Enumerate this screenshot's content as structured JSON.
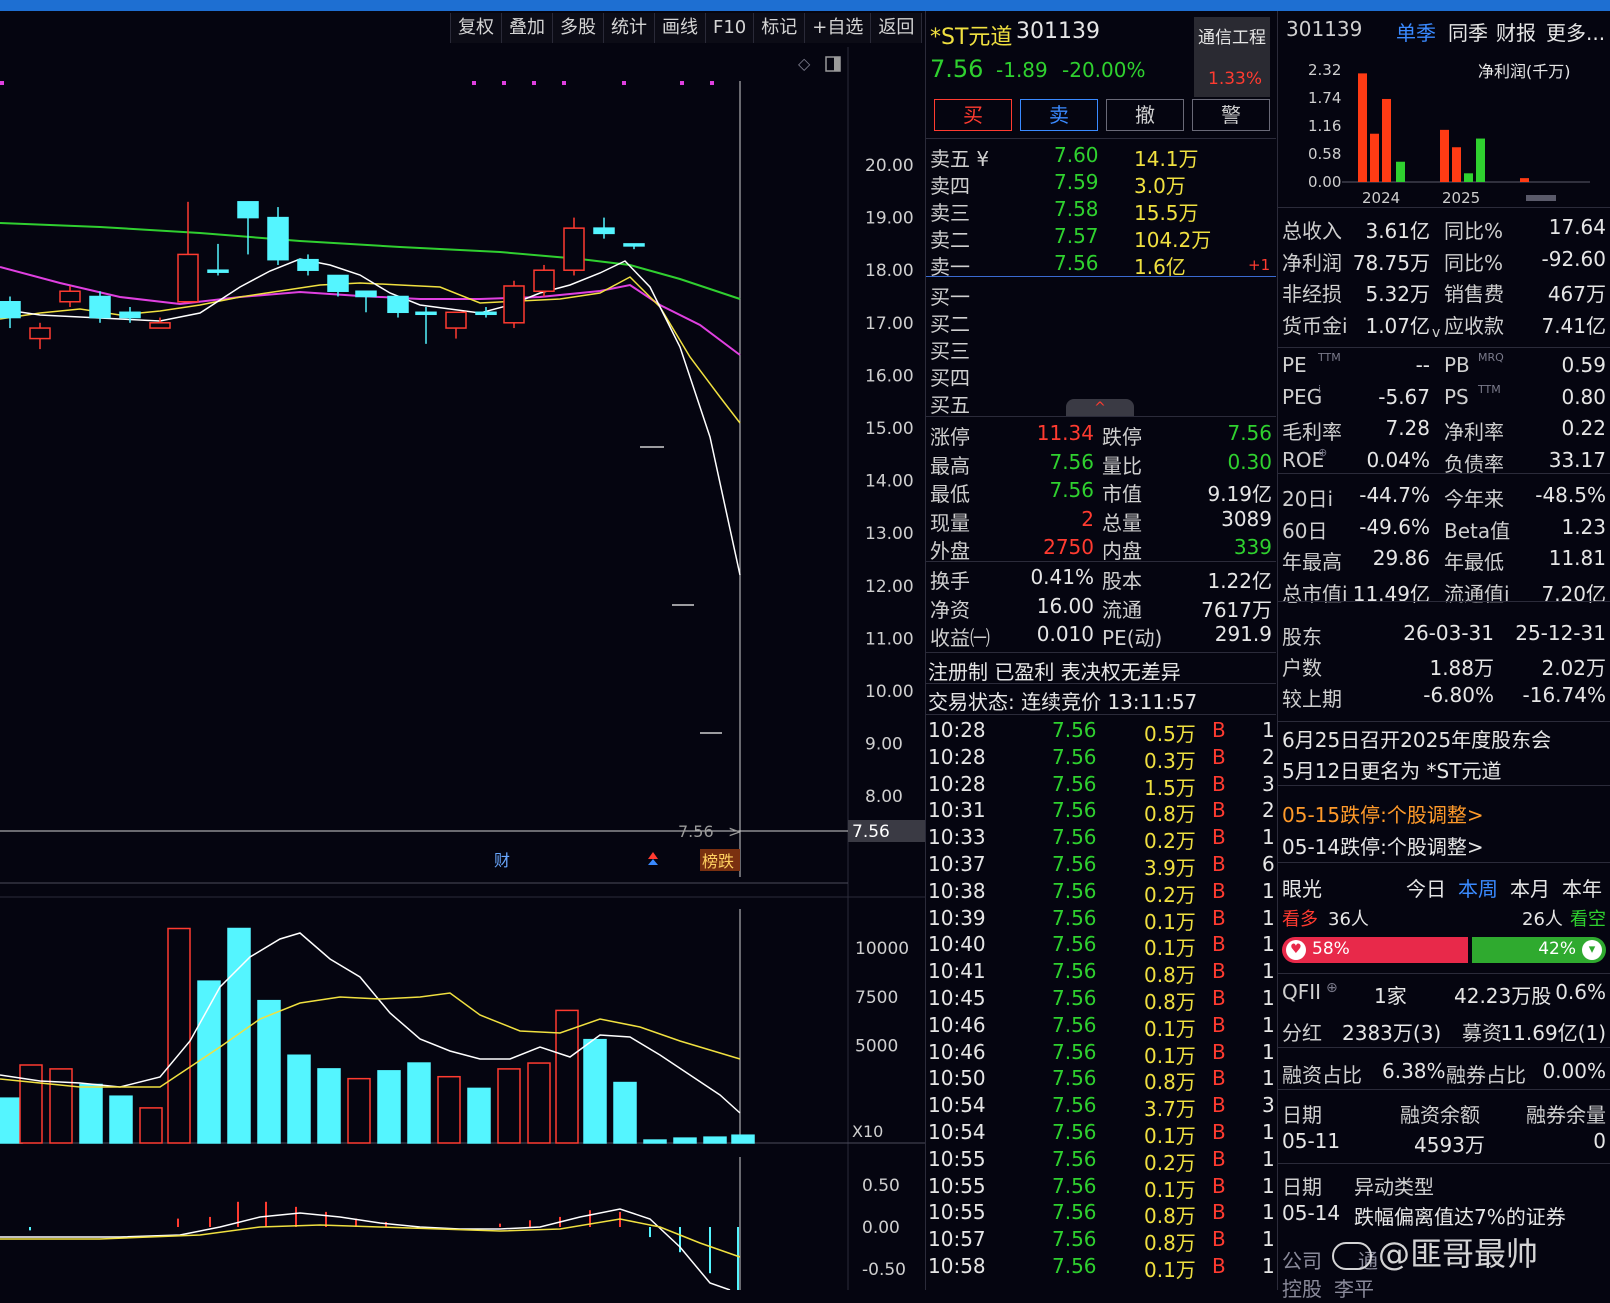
{
  "toolbar": [
    "复权",
    "叠加",
    "多股",
    "统计",
    "画线",
    "F10",
    "标记",
    "+自选",
    "返回"
  ],
  "chart": {
    "price_ticks": [
      "20.00",
      "19.00",
      "18.00",
      "17.00",
      "16.00",
      "15.00",
      "14.00",
      "13.00",
      "12.00",
      "11.00",
      "10.00",
      "9.00",
      "8.00"
    ],
    "last_price_tag": "7.56",
    "last_price_marker": "7.56",
    "last_price_arrow": ">",
    "marker_cai": "财",
    "marker_bang": "榜跌",
    "vol_ticks": [
      "10000",
      "7500",
      "5000"
    ],
    "vol_scale": "X10",
    "macd_ticks": [
      "0.50",
      "0.00",
      "-0.50"
    ],
    "colors": {
      "up": "#ff3b30",
      "down": "#54f5ff",
      "ma5": "#ffffff",
      "ma10": "#f0e040",
      "ma20": "#e040e0",
      "ma60": "#30d030"
    }
  },
  "quote": {
    "name": "*ST元道",
    "code": "301139",
    "sector": "通信工程",
    "sector_change": "1.33%",
    "price": "7.56",
    "change": "-1.89",
    "change_pct": "-20.00%",
    "buttons": {
      "buy": "买",
      "sell": "卖",
      "cancel": "撤",
      "alert": "警"
    },
    "asks": [
      {
        "label": "卖五 ¥",
        "price": "7.60",
        "vol": "14.1万",
        "extra": ""
      },
      {
        "label": "卖四",
        "price": "7.59",
        "vol": "3.0万",
        "extra": ""
      },
      {
        "label": "卖三",
        "price": "7.58",
        "vol": "15.5万",
        "extra": ""
      },
      {
        "label": "卖二",
        "price": "7.57",
        "vol": "104.2万",
        "extra": ""
      },
      {
        "label": "卖一",
        "price": "7.56",
        "vol": "1.6亿",
        "extra": "+1"
      }
    ],
    "bids": [
      "买一",
      "买二",
      "买三",
      "买四",
      "买五"
    ],
    "collapse_icon": "^",
    "stats": [
      {
        "l1": "涨停",
        "v1": "11.34",
        "c1": "red",
        "l2": "跌停",
        "v2": "7.56",
        "c2": "green"
      },
      {
        "l1": "最高",
        "v1": "7.56",
        "c1": "green",
        "l2": "量比",
        "v2": "0.30",
        "c2": "green"
      },
      {
        "l1": "最低",
        "v1": "7.56",
        "c1": "green",
        "l2": "市值",
        "v2": "9.19亿",
        "c2": "white"
      },
      {
        "l1": "现量",
        "v1": "2",
        "c1": "red",
        "l2": "总量",
        "v2": "3089",
        "c2": "white"
      },
      {
        "l1": "外盘",
        "v1": "2750",
        "c1": "red",
        "l2": "内盘",
        "v2": "339",
        "c2": "green"
      }
    ],
    "stats2": [
      {
        "l1": "换手",
        "v1": "0.41%",
        "l2": "股本",
        "v2": "1.22亿"
      },
      {
        "l1": "净资",
        "v1": "16.00",
        "l2": "流通",
        "v2": "7617万"
      },
      {
        "l1": "收益㈠",
        "v1": "0.010",
        "l2": "PE(动)",
        "v2": "291.9"
      }
    ],
    "tags": "注册制 已盈利 表决权无差异",
    "status": "交易状态: 连续竞价 13:11:57",
    "ticks": [
      {
        "t": "10:28",
        "p": "7.56",
        "v": "0.5万",
        "bs": "B",
        "n": "1"
      },
      {
        "t": "10:28",
        "p": "7.56",
        "v": "0.3万",
        "bs": "B",
        "n": "2"
      },
      {
        "t": "10:28",
        "p": "7.56",
        "v": "1.5万",
        "bs": "B",
        "n": "3"
      },
      {
        "t": "10:31",
        "p": "7.56",
        "v": "0.8万",
        "bs": "B",
        "n": "2"
      },
      {
        "t": "10:33",
        "p": "7.56",
        "v": "0.2万",
        "bs": "B",
        "n": "1"
      },
      {
        "t": "10:37",
        "p": "7.56",
        "v": "3.9万",
        "bs": "B",
        "n": "6"
      },
      {
        "t": "10:38",
        "p": "7.56",
        "v": "0.2万",
        "bs": "B",
        "n": "1"
      },
      {
        "t": "10:39",
        "p": "7.56",
        "v": "0.1万",
        "bs": "B",
        "n": "1"
      },
      {
        "t": "10:40",
        "p": "7.56",
        "v": "0.1万",
        "bs": "B",
        "n": "1"
      },
      {
        "t": "10:41",
        "p": "7.56",
        "v": "0.8万",
        "bs": "B",
        "n": "1"
      },
      {
        "t": "10:45",
        "p": "7.56",
        "v": "0.8万",
        "bs": "B",
        "n": "1"
      },
      {
        "t": "10:46",
        "p": "7.56",
        "v": "0.1万",
        "bs": "B",
        "n": "1"
      },
      {
        "t": "10:46",
        "p": "7.56",
        "v": "0.1万",
        "bs": "B",
        "n": "1"
      },
      {
        "t": "10:50",
        "p": "7.56",
        "v": "0.8万",
        "bs": "B",
        "n": "1"
      },
      {
        "t": "10:54",
        "p": "7.56",
        "v": "3.7万",
        "bs": "B",
        "n": "3"
      },
      {
        "t": "10:54",
        "p": "7.56",
        "v": "0.1万",
        "bs": "B",
        "n": "1"
      },
      {
        "t": "10:55",
        "p": "7.56",
        "v": "0.2万",
        "bs": "B",
        "n": "1"
      },
      {
        "t": "10:55",
        "p": "7.56",
        "v": "0.1万",
        "bs": "B",
        "n": "1"
      },
      {
        "t": "10:55",
        "p": "7.56",
        "v": "0.8万",
        "bs": "B",
        "n": "1"
      },
      {
        "t": "10:57",
        "p": "7.56",
        "v": "0.8万",
        "bs": "B",
        "n": "1"
      },
      {
        "t": "10:58",
        "p": "7.56",
        "v": "0.1万",
        "bs": "B",
        "n": "1"
      }
    ]
  },
  "fin": {
    "code": "301139",
    "tabs": [
      "单季",
      "同季",
      "财报",
      "更多..."
    ],
    "mini_chart_title": "净利润(千万)",
    "mini_y": [
      "2.32",
      "1.74",
      "1.16",
      "0.58",
      "0.00"
    ],
    "mini_x": [
      "2024",
      "2025"
    ],
    "mini_bars": [
      {
        "v": 2.25,
        "c": "#ff3b14"
      },
      {
        "v": 1.0,
        "c": "#ff3b14"
      },
      {
        "v": 1.72,
        "c": "#ff3b14"
      },
      {
        "v": 0.42,
        "c": "#2fd12f"
      },
      {
        "v": 1.08,
        "c": "#ff3b14"
      },
      {
        "v": 0.72,
        "c": "#ff3b14"
      },
      {
        "v": 0.18,
        "c": "#2fd12f"
      },
      {
        "v": 0.9,
        "c": "#2fd12f"
      },
      {
        "v": 0.08,
        "c": "#ff3b14"
      }
    ],
    "rows1": [
      {
        "l1": "总收入",
        "v1": "3.61亿",
        "l2": "同比%",
        "v2": "17.64"
      },
      {
        "l1": "净利润",
        "v1": "78.75万",
        "l2": "同比%",
        "v2": "-92.60"
      },
      {
        "l1": "非经损",
        "v1": "5.32万",
        "l2": "销售费",
        "v2": "467万"
      },
      {
        "l1": "货币金i",
        "v1": "1.07亿",
        "l2": "应收款",
        "v2": "7.41亿"
      }
    ],
    "expand_icon": "v",
    "rows2": [
      {
        "l1": "PE",
        "s1": "TTM",
        "v1": "--",
        "l2": "PB",
        "s2": "MRQ",
        "v2": "0.59"
      },
      {
        "l1": "PEG",
        "s1": "i",
        "v1": "-5.67",
        "l2": "PS",
        "s2": "TTM",
        "v2": "0.80"
      },
      {
        "l1": "毛利率",
        "s1": "",
        "v1": "7.28",
        "l2": "净利率",
        "s2": "",
        "v2": "0.22"
      },
      {
        "l1": "ROE",
        "s1": "⊕",
        "v1": "0.04%",
        "l2": "负债率",
        "s2": "",
        "v2": "33.17"
      }
    ],
    "rows3": [
      {
        "l1": "20日i",
        "v1": "-44.7%",
        "l2": "今年来",
        "v2": "-48.5%"
      },
      {
        "l1": "60日",
        "v1": "-49.6%",
        "l2": "Beta值",
        "v2": "1.23"
      },
      {
        "l1": "年最高",
        "v1": "29.86",
        "l2": "年最低",
        "v2": "11.81"
      },
      {
        "l1": "总市值i",
        "v1": "11.49亿",
        "l2": "流通值i",
        "v2": "7.20亿"
      }
    ],
    "holders": [
      {
        "l": "股东",
        "a": "26-03-31",
        "b": "25-12-31"
      },
      {
        "l": "户数",
        "a": "1.88万",
        "b": "2.02万"
      },
      {
        "l": "较上期",
        "a": "-6.80%",
        "b": "-16.74%"
      }
    ],
    "news": [
      "6月25日召开2025年度股东会",
      "5月12日更名为 *ST元道"
    ],
    "links": [
      "05-15跌停:个股调整>",
      "05-14跌停:个股调整>"
    ],
    "vision": {
      "title": "眼光",
      "periods": [
        "今日",
        "本周",
        "本月",
        "本年"
      ],
      "bull_label": "看多",
      "bull_count": "36人",
      "bear_count": "26人",
      "bear_label": "看空",
      "bull_pct": "58%",
      "bear_pct": "42%",
      "bull_share": 0.58
    },
    "qfii": {
      "l": "QFII",
      "a": "1家",
      "b": "42.23万股",
      "c": "0.6%"
    },
    "dividend": {
      "l": "分红",
      "a": "2383万(3)",
      "l2": "募资",
      "b": "11.69亿(1)"
    },
    "margin": {
      "l": "融资占比",
      "a": "6.38%",
      "l2": "融券占比",
      "b": "0.00%"
    },
    "margin_table": {
      "h1": "日期",
      "h2": "融资余额",
      "h3": "融券余量",
      "d": "05-11",
      "a": "4593万",
      "b": "0"
    },
    "events": {
      "h1": "日期",
      "h2": "异动类型",
      "d": "05-14",
      "t": "跌幅偏离值达7%的证券"
    },
    "footer": [
      "公司",
      "通",
      "控股",
      "李平"
    ],
    "watermark": "@匪哥最帅"
  }
}
